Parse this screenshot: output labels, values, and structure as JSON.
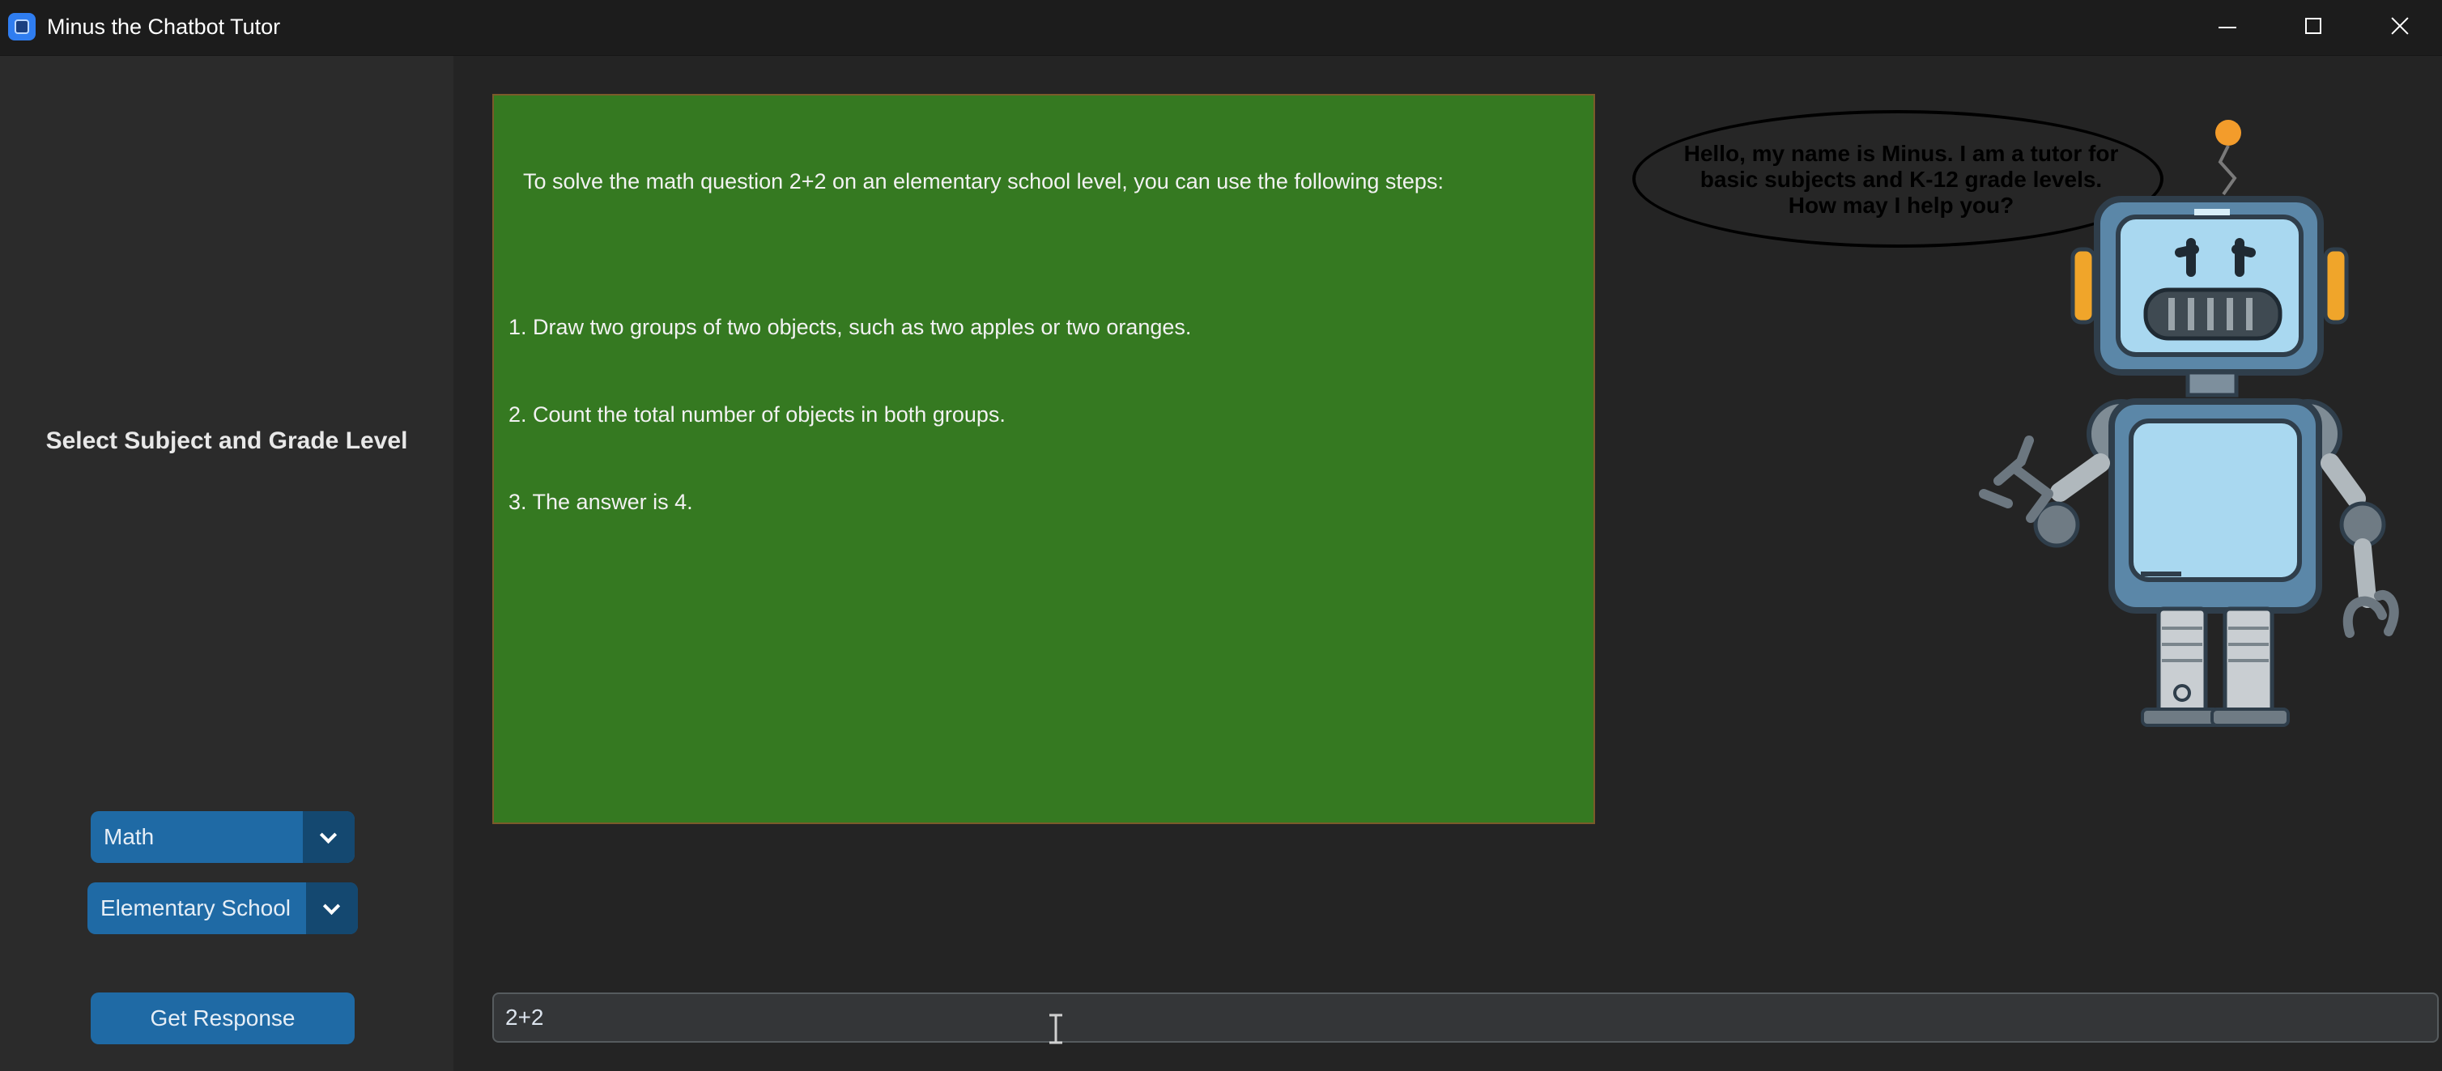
{
  "window": {
    "title": "Minus the Chatbot Tutor"
  },
  "sidebar": {
    "title": "Select Subject and Grade Level",
    "subject_dropdown": {
      "selected": "Math"
    },
    "grade_dropdown": {
      "selected": "Elementary School"
    },
    "get_response_label": "Get Response"
  },
  "response": {
    "lines": [
      "To solve the math question 2+2 on an elementary school level, you can use the following steps:",
      "",
      "1. Draw two groups of two objects, such as two apples or two oranges.",
      "2. Count the total number of objects in both groups.",
      "3. The answer is 4."
    ]
  },
  "prompt": {
    "value": "2+2"
  },
  "speech_bubble": {
    "text": "Hello, my name is Minus. I am a tutor for basic subjects and K-12 grade levels. How may I help you?"
  },
  "icons": {
    "app": "app-icon",
    "minimize": "minimize-icon",
    "maximize": "maximize-icon",
    "close": "close-icon",
    "dropdown": "chevron-down-icon",
    "text_cursor": "text-cursor-icon",
    "robot": "robot-illustration"
  },
  "colors": {
    "window_bg": "#242424",
    "sidebar_bg": "#2b2b2b",
    "button_blue": "#1f6aa5",
    "button_blue_dark": "#144870",
    "response_green": "#357921"
  }
}
